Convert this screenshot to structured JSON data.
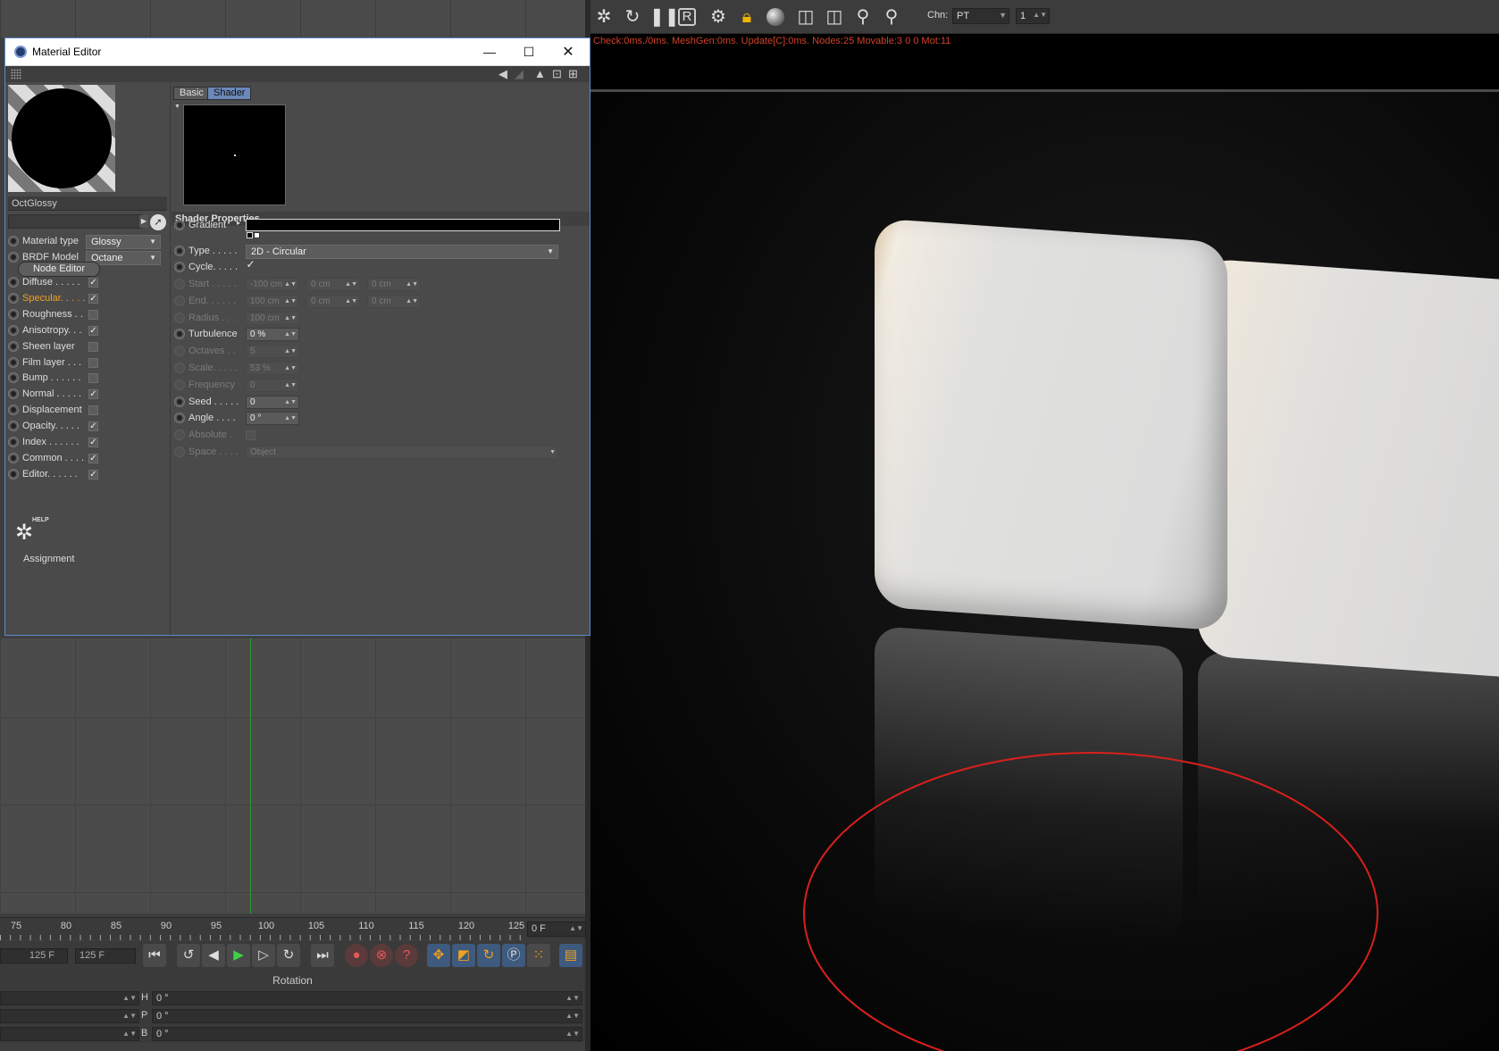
{
  "timeline": {
    "ticks": [
      "75",
      "80",
      "85",
      "90",
      "95",
      "100",
      "105",
      "110",
      "115",
      "120",
      "125"
    ],
    "frame_field": "0 F",
    "start_field": "125 F",
    "end_field": "125 F"
  },
  "attributes": {
    "header": "Rotation",
    "rows": [
      {
        "label": "H",
        "value": "0 °"
      },
      {
        "label": "P",
        "value": "0 °"
      },
      {
        "label": "B",
        "value": "0 °"
      }
    ]
  },
  "viewport": {
    "chn_label": "Chn:",
    "chn_value": "PT",
    "chn_number": "1",
    "status": "Check:0ms./0ms. MeshGen:0ms. Update[C]:0ms. Nodes:25 Movable:3  0 0 Mot:11",
    "toolbar_icons": [
      "octane-logo-icon",
      "refresh-icon",
      "pause-icon",
      "render-region-icon",
      "settings-gear-icon",
      "lock-icon",
      "material-ball-icon",
      "frame-icon",
      "frame-alt-icon",
      "pin-f-icon",
      "pin-m-icon"
    ],
    "annotation_color": "#d8201c"
  },
  "material_editor": {
    "title": "Material Editor",
    "material_name": "OctGlossy",
    "material_type_label": "Material type",
    "material_type_value": "Glossy",
    "brdf_label": "BRDF Model",
    "brdf_value": "Octane",
    "node_editor_label": "Node Editor",
    "channels": [
      {
        "label": "Diffuse . . . . .",
        "checked": true,
        "active": false
      },
      {
        "label": "Specular. . . . .",
        "checked": true,
        "active": true
      },
      {
        "label": "Roughness . .",
        "checked": false,
        "active": false
      },
      {
        "label": "Anisotropy. . .",
        "checked": true,
        "active": false
      },
      {
        "label": "Sheen layer",
        "checked": false,
        "active": false
      },
      {
        "label": "Film layer . . .",
        "checked": false,
        "active": false
      },
      {
        "label": "Bump . . . . . .",
        "checked": false,
        "active": false
      },
      {
        "label": "Normal . . . . .",
        "checked": true,
        "active": false
      },
      {
        "label": "Displacement",
        "checked": false,
        "active": false
      },
      {
        "label": "Opacity. . . . .",
        "checked": true,
        "active": false
      },
      {
        "label": "Index . . . . . .",
        "checked": true,
        "active": false
      },
      {
        "label": "Common . . . .",
        "checked": true,
        "active": false
      },
      {
        "label": "Editor. . . . . .",
        "checked": true,
        "active": false
      }
    ],
    "help_label": "HELP",
    "assignment_label": "Assignment",
    "tabs": [
      "Basic",
      "Shader"
    ],
    "active_tab": "Shader",
    "shader_properties_label": "Shader Properties",
    "gradient_label": "Gradient",
    "type_label": "Type . . . . .",
    "type_value": "2D - Circular",
    "cycle_label": "Cycle. . . . .",
    "props": [
      {
        "label": "Start . . . . .",
        "values": [
          "-100 cm",
          "0 cm",
          "0 cm"
        ],
        "enabled": false
      },
      {
        "label": "End. . . . . .",
        "values": [
          "100 cm",
          "0 cm",
          "0 cm"
        ],
        "enabled": false
      },
      {
        "label": "Radius . . .",
        "values": [
          "100 cm"
        ],
        "enabled": false
      },
      {
        "label": "Turbulence",
        "values": [
          "0 %"
        ],
        "enabled": true
      },
      {
        "label": "Octaves . .",
        "values": [
          "5"
        ],
        "enabled": false
      },
      {
        "label": "Scale. . . . .",
        "values": [
          "53 %"
        ],
        "enabled": false
      },
      {
        "label": "Frequency",
        "values": [
          "0"
        ],
        "enabled": false
      },
      {
        "label": "Seed . . . . .",
        "values": [
          "0"
        ],
        "enabled": true
      },
      {
        "label": "Angle . . . .",
        "values": [
          "0 °"
        ],
        "enabled": true
      },
      {
        "label": "Absolute .",
        "values": [],
        "enabled": false
      },
      {
        "label": "Space . . . .",
        "values": [
          "Object"
        ],
        "enabled": false
      }
    ],
    "specular_color": "#f0a020"
  }
}
